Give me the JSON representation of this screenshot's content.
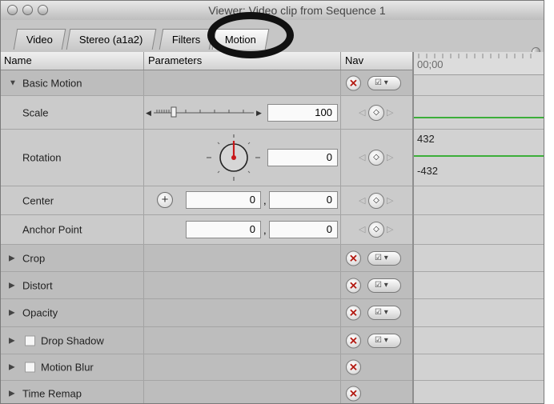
{
  "window": {
    "title": "Viewer: Video clip from Sequence 1"
  },
  "tabs": [
    {
      "label": "Video",
      "active": false
    },
    {
      "label": "Stereo (a1a2)",
      "active": false
    },
    {
      "label": "Filters",
      "active": false
    },
    {
      "label": "Motion",
      "active": true
    }
  ],
  "columns": {
    "name": "Name",
    "parameters": "Parameters",
    "nav": "Nav"
  },
  "timeline": {
    "timecode": "00;00",
    "rotation_max": "432",
    "rotation_min": "-432"
  },
  "rows": {
    "basic_motion": "Basic Motion",
    "scale": {
      "label": "Scale",
      "value": "100"
    },
    "rotation": {
      "label": "Rotation",
      "value": "0"
    },
    "center": {
      "label": "Center",
      "x": "0",
      "y": "0"
    },
    "anchor": {
      "label": "Anchor Point",
      "x": "0",
      "y": "0"
    },
    "crop": "Crop",
    "distort": "Distort",
    "opacity": "Opacity",
    "drop_shadow": "Drop Shadow",
    "motion_blur": "Motion Blur",
    "time_remap": "Time Remap"
  },
  "glyphs": {
    "x": "✕",
    "checkmenu": "☑ ▾",
    "diamond": "◇",
    "left": "◁",
    "right": "▷",
    "plus": "+",
    "comma": ",",
    "collapsed": "▶",
    "expanded": "▼"
  },
  "colors": {
    "keyframe_line": "#3cae3a",
    "reset": "#b31a12",
    "dial_needle": "#c8181a"
  }
}
